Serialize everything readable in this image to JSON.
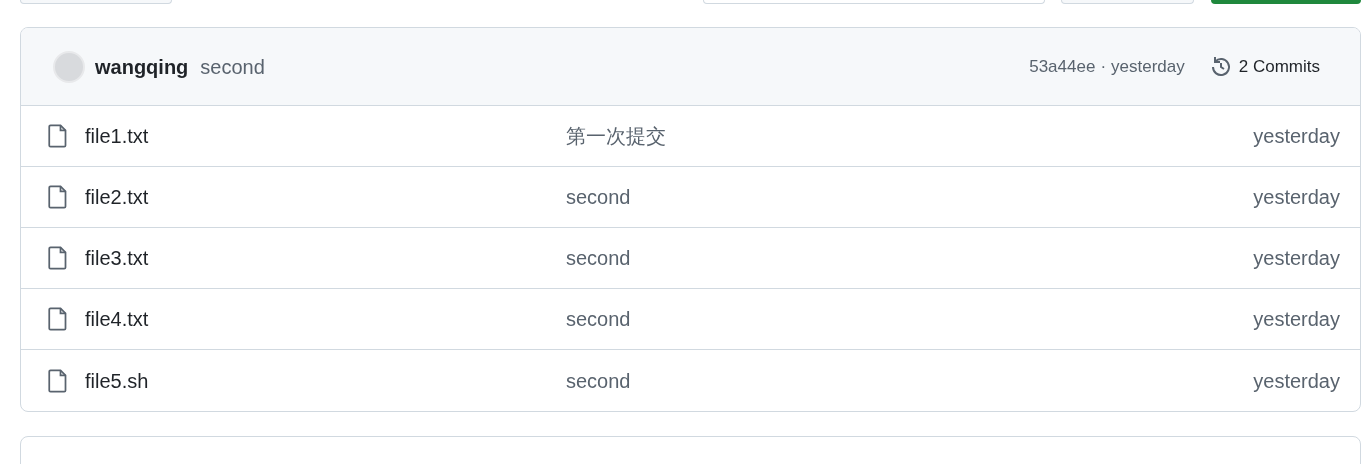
{
  "latest_commit": {
    "author": "wangqing",
    "message": "second",
    "hash": "53a44ee",
    "separator": "·",
    "time": "yesterday",
    "commits_label": "2 Commits"
  },
  "files": [
    {
      "name": "file1.txt",
      "message": "第一次提交",
      "time": "yesterday"
    },
    {
      "name": "file2.txt",
      "message": "second",
      "time": "yesterday"
    },
    {
      "name": "file3.txt",
      "message": "second",
      "time": "yesterday"
    },
    {
      "name": "file4.txt",
      "message": "second",
      "time": "yesterday"
    },
    {
      "name": "file5.sh",
      "message": "second",
      "time": "yesterday"
    }
  ]
}
